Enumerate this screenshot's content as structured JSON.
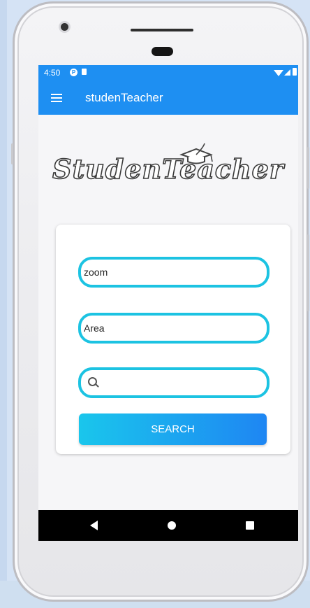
{
  "status_bar": {
    "time": "4:50"
  },
  "app_bar": {
    "title": "studenTeacher",
    "menu_icon": "hamburger-menu-icon"
  },
  "logo": {
    "text": "StudenTeacher"
  },
  "form": {
    "subject_field": {
      "value": "zoom"
    },
    "area_field": {
      "value": "Area"
    },
    "search_field": {
      "value": "",
      "icon": "search-icon"
    },
    "search_button": {
      "label": "SEARCH"
    }
  },
  "colors": {
    "primary": "#1e8ff2",
    "field_border": "#1cc3e2",
    "button_gradient_start": "#1ac6ec",
    "button_gradient_end": "#1e86f3"
  },
  "nav_bar": {
    "icons": [
      "back-icon",
      "home-icon",
      "recents-icon"
    ]
  }
}
